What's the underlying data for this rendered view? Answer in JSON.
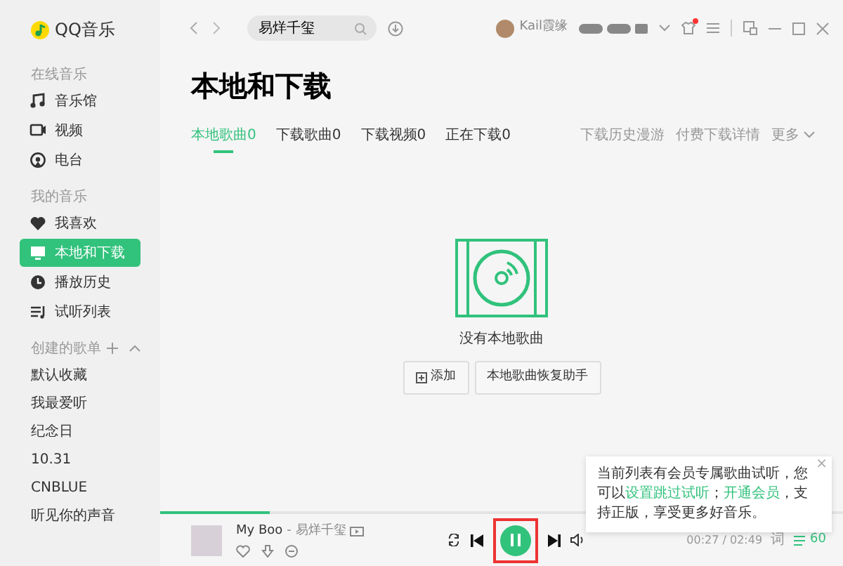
{
  "app": {
    "name": "QQ音乐"
  },
  "sidebar": {
    "sections": [
      {
        "title": "在线音乐",
        "items": [
          {
            "label": "音乐馆",
            "selected": false
          },
          {
            "label": "视频",
            "selected": false
          },
          {
            "label": "电台",
            "selected": false
          }
        ]
      },
      {
        "title": "我的音乐",
        "items": [
          {
            "label": "我喜欢",
            "selected": false
          },
          {
            "label": "本地和下载",
            "selected": true
          },
          {
            "label": "播放历史",
            "selected": false
          },
          {
            "label": "试听列表",
            "selected": false
          }
        ]
      }
    ],
    "playlists": {
      "title": "创建的歌单",
      "items": [
        "默认收藏",
        "我最爱听",
        "纪念日",
        "10.31",
        "CNBLUE",
        "听见你的声音"
      ]
    }
  },
  "topbar": {
    "search": {
      "value": "易烊千玺"
    },
    "user": {
      "name": "Kail霞缘"
    },
    "skin_notification": true
  },
  "page": {
    "title": "本地和下载",
    "tabs": [
      {
        "label": "本地歌曲0",
        "selected": true
      },
      {
        "label": "下载歌曲0",
        "selected": false
      },
      {
        "label": "下载视频0",
        "selected": false
      },
      {
        "label": "正在下载0",
        "selected": false
      }
    ],
    "links": [
      "下载历史漫游",
      "付费下载详情"
    ],
    "more": "更多"
  },
  "empty_state": {
    "message": "没有本地歌曲",
    "buttons": [
      {
        "label": "添加",
        "kind": "add"
      },
      {
        "label": "本地歌曲恢复助手",
        "kind": "plain"
      }
    ]
  },
  "player": {
    "title": "My Boo",
    "separator": "-",
    "artist": "易烊千玺",
    "level": 0.16,
    "playing": true,
    "highlighted": true,
    "time": "00:27 / 02:49",
    "lyrics": "词",
    "queue_count": "60"
  },
  "tooltip": {
    "segments": [
      {
        "kind": "text",
        "text": "当前列表有会员专属歌曲试听，您可以"
      },
      {
        "kind": "link",
        "text": "设置跳过试听"
      },
      {
        "kind": "text",
        "text": "；"
      },
      {
        "kind": "link",
        "text": "开通会员"
      },
      {
        "kind": "text",
        "text": "，支持正版，享受更多好音乐。"
      }
    ],
    "close": "×"
  }
}
